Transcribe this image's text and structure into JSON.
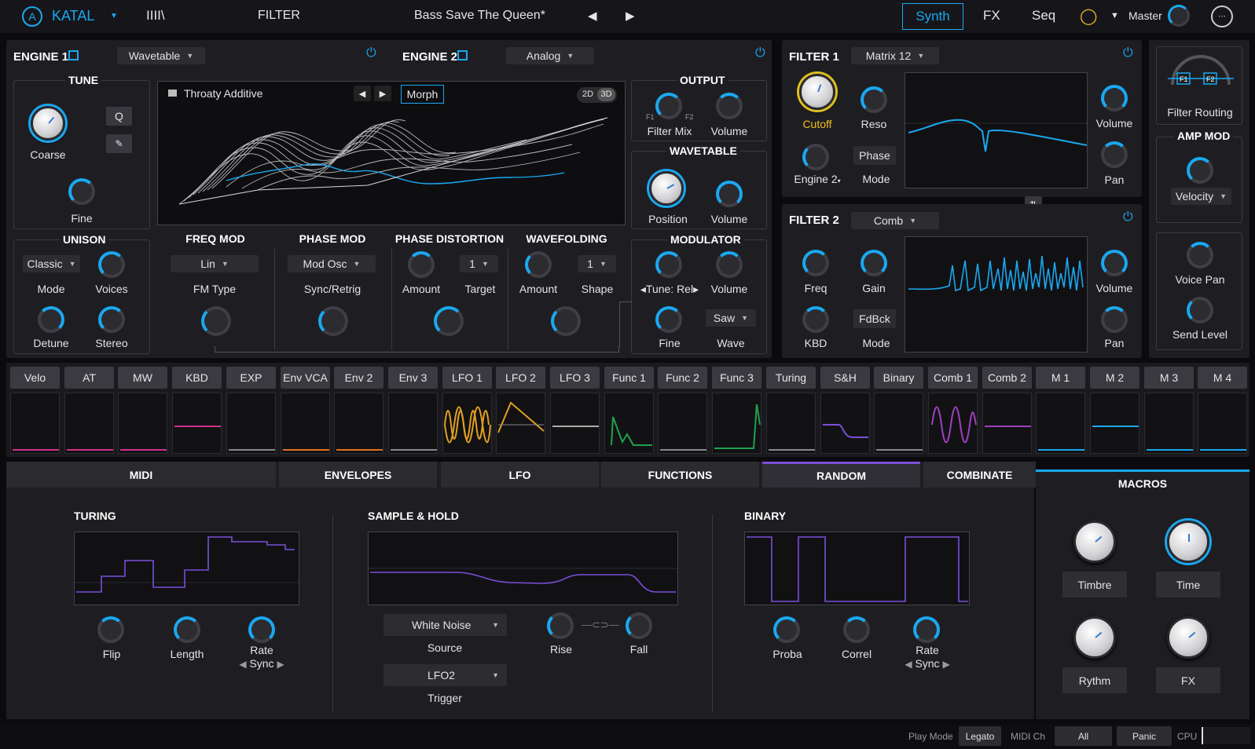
{
  "topbar": {
    "brand": "KATAL",
    "browser_icon": "IIII\\",
    "filter_label": "FILTER",
    "preset_name": "Bass Save The Queen*",
    "tabs": [
      "Synth",
      "FX",
      "Seq"
    ],
    "master_label": "Master"
  },
  "engine1": {
    "title": "ENGINE 1",
    "type": "Wavetable",
    "tune": {
      "title": "TUNE",
      "coarse": "Coarse",
      "fine": "Fine",
      "q": "Q"
    },
    "wavetable_name": "Throaty Additive",
    "morph": "Morph",
    "view2d": "2D",
    "view3d": "3D",
    "unison": {
      "title": "UNISON",
      "mode_value": "Classic",
      "mode": "Mode",
      "voices": "Voices",
      "detune": "Detune",
      "stereo": "Stereo"
    },
    "freq_mod": {
      "title": "FREQ MOD",
      "value": "Lin",
      "label": "FM Type"
    },
    "phase_mod": {
      "title": "PHASE MOD",
      "value": "Mod Osc",
      "label": "Sync/Retrig"
    },
    "phase_distortion": {
      "title": "PHASE DISTORTION",
      "amount": "Amount",
      "target_value": "1",
      "target": "Target"
    },
    "wavefolding": {
      "title": "WAVEFOLDING",
      "amount": "Amount",
      "shape_value": "1",
      "shape": "Shape"
    }
  },
  "engine2": {
    "title": "ENGINE 2",
    "type": "Analog"
  },
  "output": {
    "title": "OUTPUT",
    "filter_mix": "Filter Mix",
    "f1": "F1",
    "f2": "F2",
    "volume": "Volume"
  },
  "wavetable": {
    "title": "WAVETABLE",
    "position": "Position",
    "volume": "Volume"
  },
  "modulator": {
    "title": "MODULATOR",
    "tune": "Tune: Rel",
    "volume": "Volume",
    "fine": "Fine",
    "wave_value": "Saw",
    "wave": "Wave"
  },
  "filter1": {
    "title": "FILTER 1",
    "type": "Matrix 12",
    "cutoff": "Cutoff",
    "reso": "Reso",
    "engine": "Engine 2",
    "phase": "Phase",
    "mode": "Mode",
    "volume": "Volume",
    "pan": "Pan"
  },
  "filter2": {
    "title": "FILTER 2",
    "type": "Comb",
    "freq": "Freq",
    "gain": "Gain",
    "kbd": "KBD",
    "fdbck": "FdBck",
    "mode": "Mode",
    "volume": "Volume",
    "pan": "Pan"
  },
  "routing": {
    "label": "Filter Routing",
    "f1": "F1",
    "f2": "F2"
  },
  "amp_mod": {
    "title": "AMP MOD",
    "value": "Velocity",
    "voice_pan": "Voice Pan",
    "send_level": "Send Level"
  },
  "mod_sources": [
    "Velo",
    "AT",
    "MW",
    "KBD",
    "EXP",
    "Env VCA",
    "Env 2",
    "Env 3",
    "LFO 1",
    "LFO 2",
    "LFO 3",
    "Func 1",
    "Func 2",
    "Func 3",
    "Turing",
    "S&H",
    "Binary",
    "Comb 1",
    "Comb 2",
    "M 1",
    "M 2",
    "M 3",
    "M 4"
  ],
  "bottom_tabs": [
    "MIDI",
    "ENVELOPES",
    "LFO",
    "FUNCTIONS",
    "RANDOM",
    "COMBINATE"
  ],
  "active_tab": "RANDOM",
  "random": {
    "turing": {
      "title": "TURING",
      "flip": "Flip",
      "length": "Length",
      "rate": "Rate",
      "sync": "Sync"
    },
    "sh": {
      "title": "SAMPLE & HOLD",
      "source_value": "White Noise",
      "source": "Source",
      "trigger_value": "LFO2",
      "trigger": "Trigger",
      "rise": "Rise",
      "fall": "Fall"
    },
    "binary": {
      "title": "BINARY",
      "proba": "Proba",
      "correl": "Correl",
      "rate": "Rate",
      "sync": "Sync"
    }
  },
  "macros": {
    "title": "MACROS",
    "items": [
      "Timbre",
      "Time",
      "Rythm",
      "FX"
    ]
  },
  "status": {
    "play_mode": "Play Mode",
    "play_mode_value": "Legato",
    "midi_ch": "MIDI Ch",
    "midi_ch_value": "All",
    "panic": "Panic",
    "cpu": "CPU"
  },
  "colors": {
    "accent": "#1aa8f0",
    "random_purple": "#7a4fd8",
    "cutoff_label": "#f0c020"
  }
}
